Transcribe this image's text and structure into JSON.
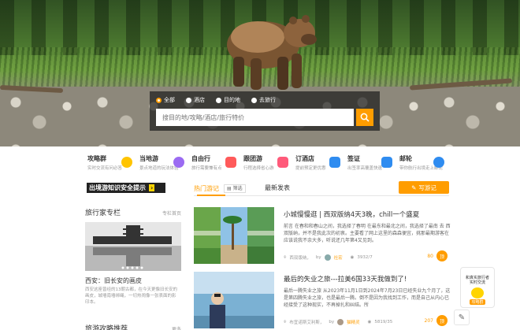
{
  "search": {
    "tabs": [
      {
        "label": "全部",
        "selected": true
      },
      {
        "label": "酒店",
        "selected": false
      },
      {
        "label": "目的地",
        "selected": false
      },
      {
        "label": "去旅行",
        "selected": false
      }
    ],
    "placeholder": "搜目的地/攻略/酒店/旅行特价"
  },
  "quicknav": [
    {
      "title": "攻略群",
      "sub": "实时交流有问必答",
      "icon_color": "#ffc400",
      "icon": "smiley-icon"
    },
    {
      "title": "当地游",
      "sub": "景点地道的玩法体验",
      "icon_color": "#9b6bf2",
      "icon": "balloon-icon"
    },
    {
      "title": "自由行",
      "sub": "旅行需要兼有点",
      "icon_color": "#ff5a5a",
      "icon": "gift-icon"
    },
    {
      "title": "跟团游",
      "sub": "行程选择省心游",
      "icon_color": "#ff5a7a",
      "icon": "flag-icon"
    },
    {
      "title": "订酒店",
      "sub": "提前预定更优惠",
      "icon_color": "#2f8cf0",
      "icon": "hotel-icon"
    },
    {
      "title": "签证",
      "sub": "出签率高覆盖快速",
      "icon_color": "#2f8cf0",
      "icon": "passport-icon"
    },
    {
      "title": "邮轮",
      "sub": "带你航行出境走上邮轮",
      "icon_color": "#2f8cf0",
      "icon": "ship-icon"
    }
  ],
  "left": {
    "safety_banner": "出境游知识安全提示",
    "column_title": "旅行家专栏",
    "column_more": "专栏首页",
    "column_item_title": "西安：旧长安的画皮",
    "column_item_desc": "西安这座曾经的13朝古都，在今天更像旧长安的画皮，城墙南墙绑绳，一切热闹像一张表面的影印本。",
    "guide_title": "旅游攻略推荐",
    "guide_more": "更多"
  },
  "tabs": {
    "hot": "热门游记",
    "filter": "筛选",
    "latest": "最新发表",
    "write": "写游记"
  },
  "articles": [
    {
      "title": "小城慢慢逛 | 西双版纳4天3晚，chill一个盛夏",
      "summary": "前言 在春和和春山之间，我选择了春明 在最东和最北之间，我选择了最南 去 西双版纳，并不是我此次的初衷。主要看了网上这里的森森便宜，挑那最期游客在应该说我不余大多，听说还几年第4又见到。",
      "location": "西双版纳，",
      "by": "by",
      "author": "社宏",
      "views": "3932/7",
      "likes": "80",
      "badge": "顶"
    },
    {
      "title": "最后的失业之旅---拉美6国33天我做到了!",
      "summary": "最后一腾失业之旅 从2023年11月1日到2024年7月23日已经失业九个月了，这是第四腾失业之旅，也是最后一腾。倒不是因为我找到工作，而是自己从内心已经接受了这种现实，不再掉扎和纠结。所",
      "location": "布宜诺斯艾利斯，",
      "by": "by",
      "author": "猫精灵",
      "views": "5819/35",
      "likes": "207",
      "badge": "顶"
    }
  ],
  "float": {
    "line1": "和真实旅行者",
    "line2": "实时交流",
    "tag": "攻略群"
  },
  "colors": {
    "accent": "#ff9d00"
  }
}
